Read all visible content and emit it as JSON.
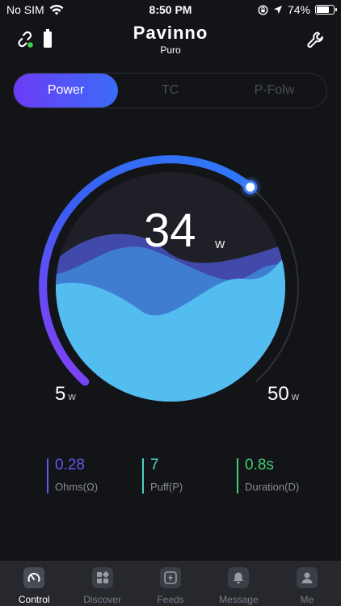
{
  "status_bar": {
    "carrier": "No SIM",
    "time": "8:50 PM",
    "battery_percent": "74%",
    "battery_level": 0.74
  },
  "header": {
    "brand": "Pavinno",
    "device": "Puro",
    "left_icons": [
      "link-icon",
      "battery-icon"
    ],
    "right_icon": "wrench-icon"
  },
  "mode_tabs": [
    {
      "label": "Power",
      "active": true
    },
    {
      "label": "TC",
      "active": false
    },
    {
      "label": "P-Folw",
      "active": false
    }
  ],
  "gauge": {
    "value": "34",
    "unit": "w",
    "min_value": "5",
    "min_unit": "w",
    "max_value": "50",
    "max_unit": "w",
    "level_fraction": 0.64
  },
  "stats": [
    {
      "value": "0.28",
      "label": "Ohms(Ω)",
      "color": "#5b5bf0"
    },
    {
      "value": "7",
      "label": "Puff(P)",
      "color": "#4fd0c0"
    },
    {
      "value": "0.8s",
      "label": "Duration(D)",
      "color": "#3fcf72"
    }
  ],
  "colors": {
    "accent_purple": "#6b3cf7",
    "accent_blue": "#3a6cf8",
    "liquid": "#53bfef",
    "background": "#131418"
  },
  "tabbar": [
    {
      "label": "Control",
      "icon": "gauge-icon",
      "active": true
    },
    {
      "label": "Discover",
      "icon": "grid-icon",
      "active": false
    },
    {
      "label": "Feeds",
      "icon": "bolt-icon",
      "active": false
    },
    {
      "label": "Message",
      "icon": "bell-icon",
      "active": false
    },
    {
      "label": "Me",
      "icon": "person-icon",
      "active": false
    }
  ]
}
